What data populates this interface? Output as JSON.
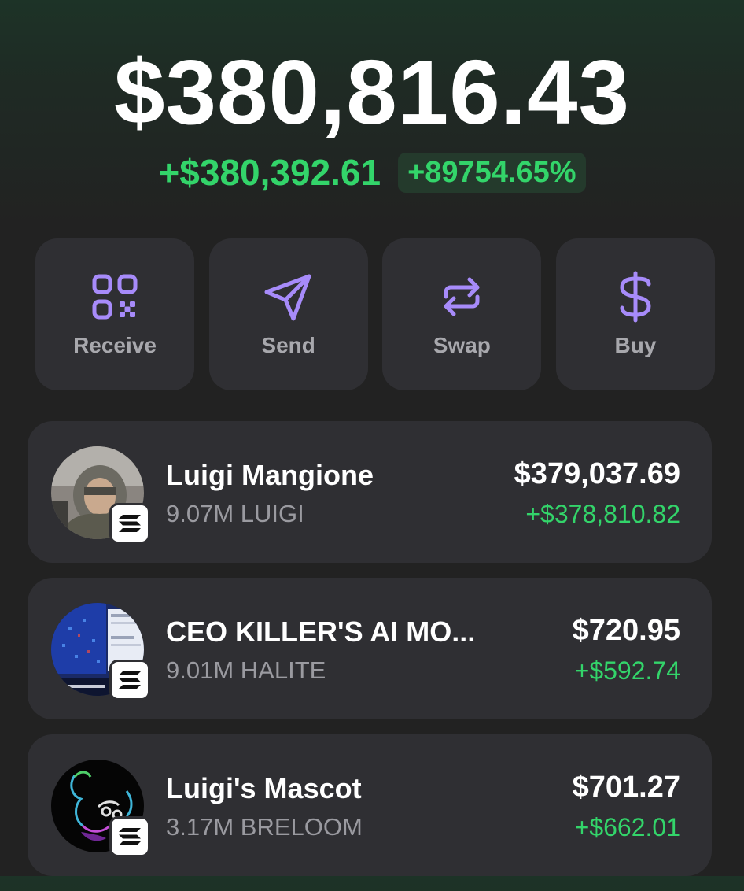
{
  "portfolio": {
    "balance": "$380,816.43",
    "change_amount": "+$380,392.61",
    "change_percent": "+89754.65%"
  },
  "colors": {
    "accent": "#a78bfa",
    "positive": "#33d46a",
    "card": "#2f2f33",
    "background": "#222222"
  },
  "actions": [
    {
      "label": "Receive",
      "icon": "qr-code-icon"
    },
    {
      "label": "Send",
      "icon": "paper-plane-icon"
    },
    {
      "label": "Swap",
      "icon": "swap-arrows-icon"
    },
    {
      "label": "Buy",
      "icon": "dollar-icon"
    }
  ],
  "tokens": [
    {
      "name": "Luigi Mangione",
      "amount": "9.07M LUIGI",
      "value": "$379,037.69",
      "change": "+$378,810.82",
      "avatar": "hooded-person-photo",
      "chain_icon": "solana-icon"
    },
    {
      "name": "CEO KILLER'S AI MO...",
      "amount": "9.01M HALITE",
      "value": "$720.95",
      "change": "+$592.74",
      "avatar": "game-screenshot-image",
      "chain_icon": "solana-icon"
    },
    {
      "name": "Luigi's Mascot",
      "amount": "3.17M BRELOOM",
      "value": "$701.27",
      "change": "+$662.01",
      "avatar": "neon-creature-drawing",
      "chain_icon": "solana-icon"
    }
  ]
}
